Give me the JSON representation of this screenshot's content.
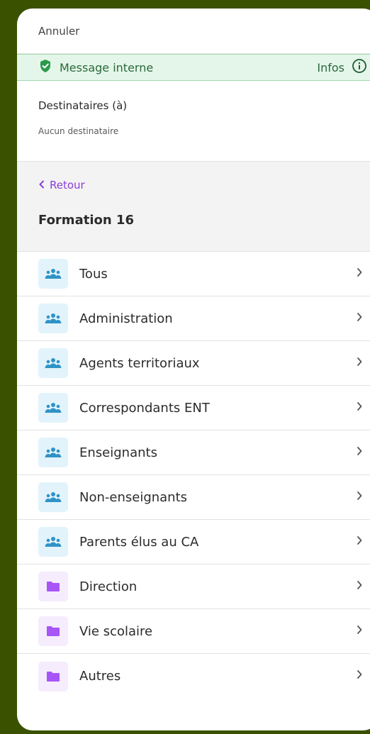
{
  "header": {
    "cancel_label": "Annuler"
  },
  "banner": {
    "label": "Message interne",
    "info_label": "Infos",
    "color": "#2b9a4a"
  },
  "recipients": {
    "title": "Destinataires (à)",
    "empty_text": "Aucun destinataire"
  },
  "nav": {
    "back_label": "Retour",
    "group_title": "Formation 16"
  },
  "items": [
    {
      "label": "Tous",
      "icon": "group-icon"
    },
    {
      "label": "Administration",
      "icon": "group-icon"
    },
    {
      "label": "Agents territoriaux",
      "icon": "group-icon"
    },
    {
      "label": "Correspondants ENT",
      "icon": "group-icon"
    },
    {
      "label": "Enseignants",
      "icon": "group-icon"
    },
    {
      "label": "Non-enseignants",
      "icon": "group-icon"
    },
    {
      "label": "Parents élus au CA",
      "icon": "group-icon"
    },
    {
      "label": "Direction",
      "icon": "folder-icon"
    },
    {
      "label": "Vie scolaire",
      "icon": "folder-icon"
    },
    {
      "label": "Autres",
      "icon": "folder-icon"
    }
  ],
  "colors": {
    "accent": "#8a3ed6",
    "group_icon": "#2f93c7",
    "folder_icon": "#a855f7"
  }
}
